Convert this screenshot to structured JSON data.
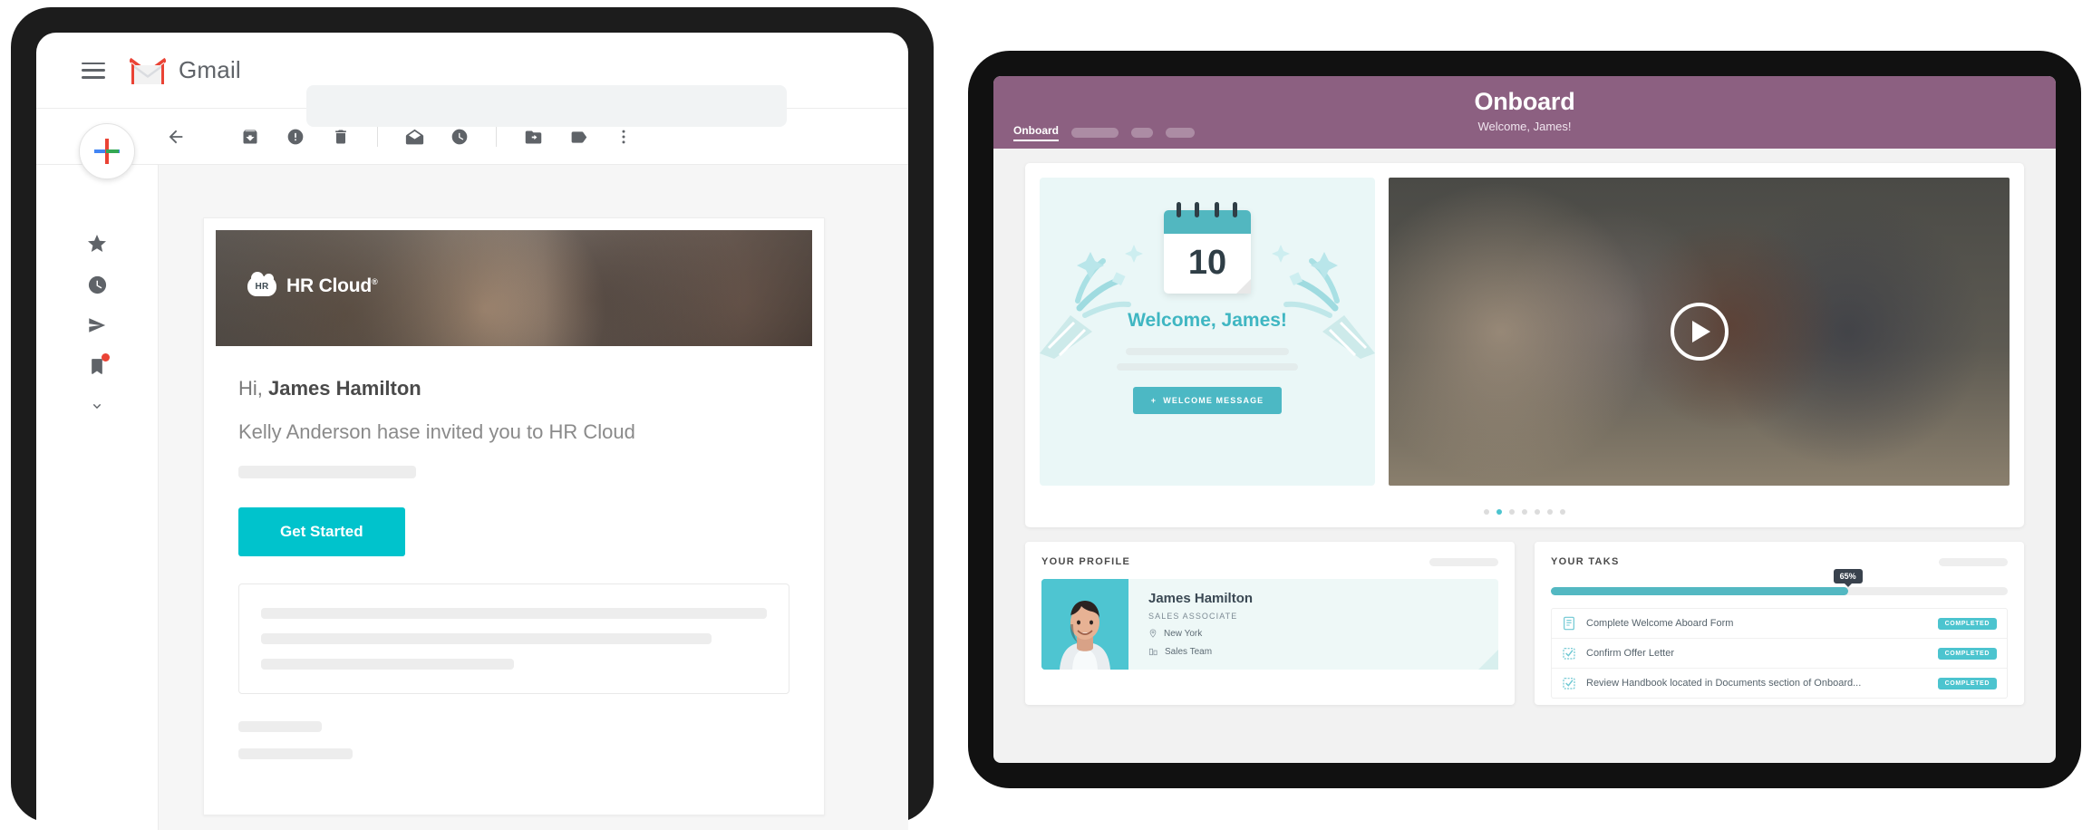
{
  "gmail": {
    "brand": "Gmail",
    "menu_icon": "hamburger-icon",
    "search_placeholder": "",
    "toolbar": [
      {
        "name": "back-icon",
        "label": "Back"
      },
      {
        "name": "archive-icon",
        "label": "Archive"
      },
      {
        "name": "report-spam-icon",
        "label": "Report spam"
      },
      {
        "name": "delete-icon",
        "label": "Delete"
      },
      {
        "name": "mark-unread-icon",
        "label": "Mark as unread"
      },
      {
        "name": "snooze-icon",
        "label": "Snooze"
      },
      {
        "name": "move-to-folder-icon",
        "label": "Move to"
      },
      {
        "name": "label-icon",
        "label": "Labels"
      },
      {
        "name": "more-options-icon",
        "label": "More"
      }
    ],
    "rail": [
      {
        "name": "starred-icon",
        "label": "Starred"
      },
      {
        "name": "snoozed-icon",
        "label": "Snoozed"
      },
      {
        "name": "sent-icon",
        "label": "Sent"
      },
      {
        "name": "drafts-icon",
        "label": "Drafts"
      },
      {
        "name": "expand-more-icon",
        "label": "More"
      }
    ],
    "compose_label": "Compose"
  },
  "email": {
    "hero_brand": "HR Cloud",
    "hero_mark": "HR",
    "hero_trademark": "®",
    "greeting_prefix": "Hi,",
    "recipient": "James Hamilton",
    "subline": "Kelly Anderson hase invited you to HR Cloud",
    "cta_label": "Get Started"
  },
  "onboard": {
    "title": "Onboard",
    "subtitle": "Welcome, James!",
    "active_tab": "Onboard",
    "header_color": "#8c6081",
    "accent_color": "#4cc4cf",
    "welcome": {
      "calendar_day": "10",
      "heading": "Welcome, James!",
      "button_label": "WELCOME MESSAGE",
      "button_icon": "plus-icon"
    },
    "video": {
      "play_icon": "play-icon",
      "carousel_dots": 7,
      "active_dot": 2
    },
    "profile": {
      "panel_title": "YOUR PROFILE",
      "name": "James Hamilton",
      "role": "SALES ASSOCIATE",
      "location": "New York",
      "location_icon": "map-pin-icon",
      "team": "Sales Team",
      "team_icon": "department-icon"
    },
    "tasks": {
      "panel_title": "YOUR TAKS",
      "progress_label": "65%",
      "progress_value": 65,
      "items": [
        {
          "icon": "form-document-icon",
          "label": "Complete Welcome Aboard Form",
          "status": "COMPLETED"
        },
        {
          "icon": "checkbox-icon",
          "label": "Confirm Offer Letter",
          "status": "COMPLETED"
        },
        {
          "icon": "checkbox-icon",
          "label": "Review Handbook located in Documents section of Onboard...",
          "status": "COMPLETED"
        }
      ]
    }
  }
}
